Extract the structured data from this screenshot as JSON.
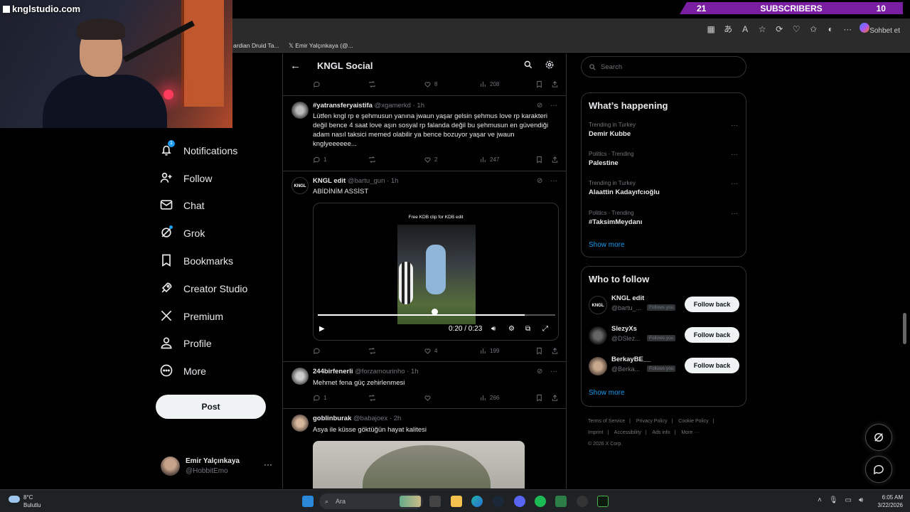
{
  "overlay": {
    "brand": "knglstudio.com",
    "subs_left": "21",
    "subs_label": "SUBSCRIBERS",
    "subs_right": "10"
  },
  "browser": {
    "copilot_label": "Sohbet et",
    "bookmarks": [
      "ardian Druid Ta...",
      "Emir Yalçınkaya (@..."
    ]
  },
  "nav": {
    "items": [
      {
        "label": "Notifications",
        "icon": "bell-icon",
        "badge": "1"
      },
      {
        "label": "Follow",
        "icon": "person-add-icon"
      },
      {
        "label": "Chat",
        "icon": "mail-icon"
      },
      {
        "label": "Grok",
        "icon": "grok-icon"
      },
      {
        "label": "Bookmarks",
        "icon": "bookmark-icon"
      },
      {
        "label": "Creator Studio",
        "icon": "rocket-icon"
      },
      {
        "label": "Premium",
        "icon": "x-logo-icon"
      },
      {
        "label": "Profile",
        "icon": "person-icon"
      },
      {
        "label": "More",
        "icon": "more-circle-icon"
      }
    ],
    "post_label": "Post",
    "account": {
      "name": "Emir Yalçınkaya",
      "handle": "@HobbitEmo"
    }
  },
  "main": {
    "title": "KNGL Social",
    "top_actions": {
      "likes": "8",
      "views": "208"
    },
    "tweets": [
      {
        "name": "#yatransferyaistifa",
        "handle": "@xgamerkd",
        "time": "1h",
        "text": "Lütfen kngl rp e şehmusun yanına jwaun yaşar gelsin şehmus love rp karakteri değil bence 4 saat love aşın sosyal rp falanda değil bu şehmusun en güvendiği adam nasıl taksici memed olabilir ya bence bozuyor yaşar ve jwaun knglyeeeeee...",
        "replies": "1",
        "likes": "2",
        "views": "247"
      },
      {
        "name": "KNGL edit",
        "handle": "@bartu_gun",
        "time": "1h",
        "text": "ABİDİNİM ASSİST",
        "video_caption": "Free KDB clip for KDB edit",
        "video_time": "0:20 / 0:23",
        "video_progress": 0.87,
        "replies": "",
        "likes": "4",
        "views": "199"
      },
      {
        "name": "244birfenerli",
        "handle": "@forzamourinho",
        "time": "1h",
        "text": "Mehmet fena güç zehirlenmesi",
        "replies": "1",
        "likes": "",
        "views": "266"
      },
      {
        "name": "goblinburak",
        "handle": "@babajoex",
        "time": "2h",
        "text": "Asya ile küsse göktüğün hayat kalitesi"
      }
    ]
  },
  "right": {
    "search_placeholder": "Search",
    "happening_title": "What’s happening",
    "trends": [
      {
        "category": "Trending in Turkey",
        "title": "Demir Kubbe"
      },
      {
        "category": "Politics · Trending",
        "title": "Palestine"
      },
      {
        "category": "Trending in Turkey",
        "title": "Alaattin Kadayıfcıoğlu"
      },
      {
        "category": "Politics · Trending",
        "title": "#TaksimMeydanı"
      }
    ],
    "show_more": "Show more",
    "wtf_title": "Who to follow",
    "who_to_follow": [
      {
        "name": "KNGL edit",
        "handle": "@bartu_...",
        "follows_you": "Follows you",
        "button": "Follow back"
      },
      {
        "name": "SlezyXs",
        "handle": "@DSlez...",
        "follows_you": "Follows you",
        "button": "Follow back"
      },
      {
        "name": "BerkayBE__",
        "handle": "@Berka...",
        "follows_you": "Follows you",
        "button": "Follow back"
      }
    ],
    "footer": [
      "Terms of Service",
      "|",
      "Privacy Policy",
      "|",
      "Cookie Policy",
      "|",
      "Imprint",
      "|",
      "Accessibility",
      "|",
      "Ads info",
      "|",
      "More ···",
      "© 2026 X Corp."
    ]
  },
  "taskbar": {
    "temp": "8°C",
    "weather": "Bulutlu",
    "search": "Ara",
    "time": "6:05 AM",
    "date": "3/22/2026"
  }
}
